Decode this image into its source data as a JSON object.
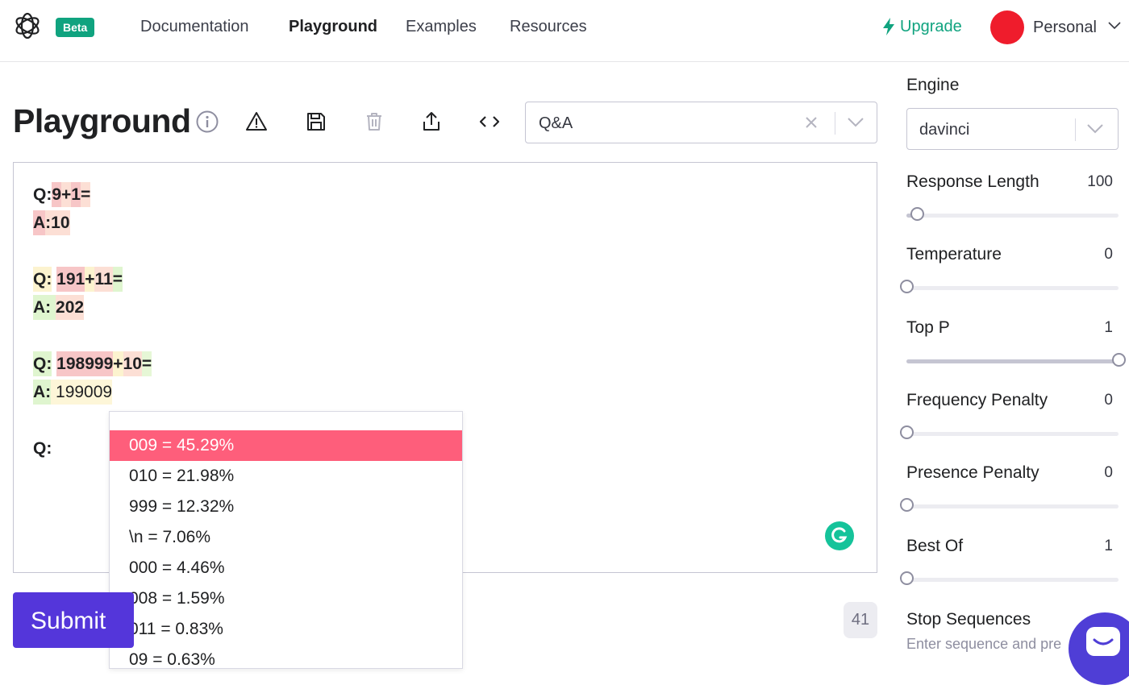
{
  "nav": {
    "beta": "Beta",
    "links": [
      "Documentation",
      "Playground",
      "Examples",
      "Resources"
    ],
    "upgrade": "Upgrade",
    "account": "Personal"
  },
  "playground": {
    "title": "Playground",
    "preset": "Q&A"
  },
  "prompt": [
    [
      {
        "t": "Q:",
        "b": true,
        "c": ""
      },
      {
        "t": "9",
        "b": true,
        "c": "p-red"
      },
      {
        "t": "+",
        "b": true,
        "c": "p-pink"
      },
      {
        "t": "1",
        "b": true,
        "c": "p-red"
      },
      {
        "t": "=",
        "b": true,
        "c": "p-pink"
      }
    ],
    [
      {
        "t": "A",
        "b": true,
        "c": "p-red"
      },
      {
        "t": ":",
        "b": true,
        "c": "p-pink"
      },
      {
        "t": "10",
        "b": true,
        "c": "p-pink"
      }
    ],
    [],
    [
      {
        "t": "Q:",
        "b": true,
        "c": "p-yellow"
      },
      {
        "t": " ",
        "b": true,
        "c": ""
      },
      {
        "t": "191",
        "b": true,
        "c": "p-red"
      },
      {
        "t": "+",
        "b": true,
        "c": "p-yellow"
      },
      {
        "t": "11",
        "b": true,
        "c": "p-pink"
      },
      {
        "t": "=",
        "b": true,
        "c": "p-green"
      }
    ],
    [
      {
        "t": "A:",
        "b": true,
        "c": "p-green"
      },
      {
        "t": " ",
        "b": true,
        "c": "p-green"
      },
      {
        "t": "202",
        "b": true,
        "c": "p-pink"
      }
    ],
    [],
    [
      {
        "t": "Q:",
        "b": true,
        "c": "p-green"
      },
      {
        "t": " ",
        "b": true,
        "c": ""
      },
      {
        "t": "198999",
        "b": true,
        "c": "p-red"
      },
      {
        "t": "+",
        "b": true,
        "c": "p-yellow"
      },
      {
        "t": "10",
        "b": true,
        "c": "p-pink"
      },
      {
        "t": "=",
        "b": true,
        "c": "p-lgreen"
      }
    ],
    [
      {
        "t": "A:",
        "b": true,
        "c": "p-green"
      },
      {
        "t": " ",
        "b": false,
        "c": "p-lyellow"
      },
      {
        "t": "199009",
        "b": false,
        "c": "p-lyellow"
      }
    ],
    [],
    [
      {
        "t": "Q:",
        "b": true,
        "c": ""
      }
    ]
  ],
  "probabilities": [
    "009 = 45.29%",
    "010 = 21.98%",
    "999 = 12.32%",
    "\\n = 7.06%",
    "000 = 4.46%",
    "008 = 1.59%",
    "011 = 0.83%",
    "09 = 0.63%"
  ],
  "submit_label": "Submit",
  "token_count": "41",
  "settings": {
    "engine_label": "Engine",
    "engine_value": "davinci",
    "sliders": [
      {
        "label": "Response Length",
        "value": "100",
        "fraction": 0.05
      },
      {
        "label": "Temperature",
        "value": "0",
        "fraction": 0.0
      },
      {
        "label": "Top P",
        "value": "1",
        "fraction": 1.0
      },
      {
        "label": "Frequency Penalty",
        "value": "0",
        "fraction": 0.0
      },
      {
        "label": "Presence Penalty",
        "value": "0",
        "fraction": 0.0
      },
      {
        "label": "Best Of",
        "value": "1",
        "fraction": 0.0
      }
    ],
    "stop_label": "Stop Sequences",
    "stop_placeholder": "Enter sequence and pre"
  },
  "colors": {
    "accent": "#10a37f",
    "submit": "#5436da",
    "highlight": "#fe5e7b"
  }
}
